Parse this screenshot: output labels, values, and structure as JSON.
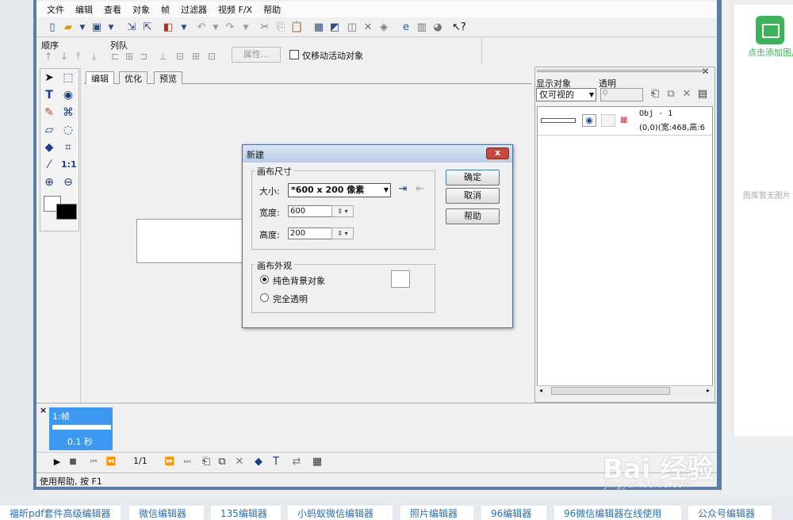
{
  "menu": [
    "文件",
    "编辑",
    "查看",
    "对象",
    "帧",
    "过滤器",
    "视频 F/X",
    "帮助"
  ],
  "arrange": {
    "order_label": "顺序",
    "queue_label": "列队",
    "property_button": "属性...",
    "move_active_label": "仅移动活动对象"
  },
  "editor_tabs": [
    "编辑",
    "优化",
    "预览"
  ],
  "objects_panel": {
    "show_label": "显示对象",
    "opacity_label": "透明",
    "show_value": "仅可视的",
    "opacity_value": "0",
    "object_name": "Obj - 1",
    "object_info": "(0,0)(宽:468,高:6"
  },
  "timeline": {
    "frame_label": "1:帧",
    "frame_time": "0.1 秒",
    "frame_counter": "1/1"
  },
  "status": "使用帮助, 按 F1",
  "dialog": {
    "title": "新建",
    "close_glyph": "x",
    "canvas_size_group": "画布尺寸",
    "size_label": "大小:",
    "size_value": "*600 x 200 像素",
    "width_label": "宽度:",
    "width_value": "600",
    "height_label": "高度:",
    "height_value": "200",
    "appearance_group": "画布外观",
    "option_solid": "纯色背景对象",
    "option_transparent": "完全透明",
    "ok": "确定",
    "cancel": "取消",
    "help": "帮助"
  },
  "right_panel": {
    "add_image": "点击添加图片",
    "empty": "图库暂无图片"
  },
  "bottom_tabs": [
    "福昕pdf套件高级编辑器",
    "微信编辑器",
    "135编辑器",
    "小蚂蚁微信编辑器",
    "照片编辑器",
    "96编辑器",
    "96微信编辑器在线使用",
    "公众号编辑器"
  ],
  "watermark": {
    "main": "Bai 经验",
    "sub": "jingyan.baidu.com"
  },
  "colors": {
    "frame_blue": "#3d98f2",
    "title_bar": "#b7cce6",
    "close_red": "#c9463d",
    "link_blue": "#2870b5"
  }
}
